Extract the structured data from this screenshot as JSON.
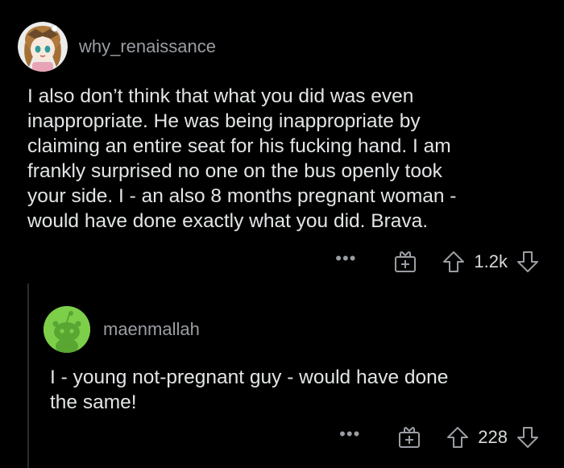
{
  "colors": {
    "background": "#000000",
    "text": "#e2e4e6",
    "muted": "#9a9ea3",
    "thread_line": "#2a2b2d",
    "reply_avatar_bg": "#7dcf4a"
  },
  "comment": {
    "username": "why_renaissance",
    "avatar_icon": "anime-avatar-icon",
    "body": "I also don’t think that what you did was even\ninappropriate. He was being inappropriate by\nclaiming an entire seat for his fucking hand. I am\nfrankly surprised no one on the bus openly took\nyour side. I - an also 8 months pregnant woman -\nwould have done exactly what you did. Brava.",
    "more_label": "•••",
    "score": "1.2k"
  },
  "reply": {
    "username": "maenmallah",
    "avatar_icon": "snoo-avatar-icon",
    "body": "I - young not-pregnant guy - would have done\nthe same!",
    "more_label": "•••",
    "score": "228"
  }
}
